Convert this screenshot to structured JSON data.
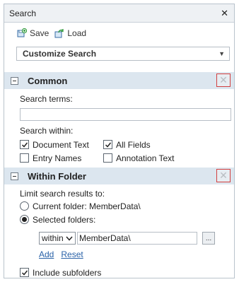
{
  "panel": {
    "title": "Search",
    "close_glyph": "✕"
  },
  "toolbar": {
    "save_label": "Save",
    "load_label": "Load"
  },
  "customize": {
    "label": "Customize Search"
  },
  "common": {
    "title": "Common",
    "search_terms_label": "Search terms:",
    "search_terms_value": "",
    "search_within_label": "Search within:",
    "options": [
      {
        "label": "Document Text",
        "checked": true
      },
      {
        "label": "All Fields",
        "checked": true
      },
      {
        "label": "Entry Names",
        "checked": false
      },
      {
        "label": "Annotation Text",
        "checked": false
      }
    ]
  },
  "within_folder": {
    "title": "Within Folder",
    "limit_label": "Limit search results to:",
    "radios": [
      {
        "label": "Current folder: MemberData\\",
        "selected": false
      },
      {
        "label": "Selected folders:",
        "selected": true
      }
    ],
    "scope_value": "within",
    "folder_value": "MemberData\\",
    "browse_label": "...",
    "add_label": "Add",
    "reset_label": "Reset",
    "include_subfolders_label": "Include subfolders",
    "include_subfolders_checked": true
  },
  "colors": {
    "header_bg": "#dce6ef",
    "link": "#2a62a8",
    "highlight_border": "#d24040"
  }
}
